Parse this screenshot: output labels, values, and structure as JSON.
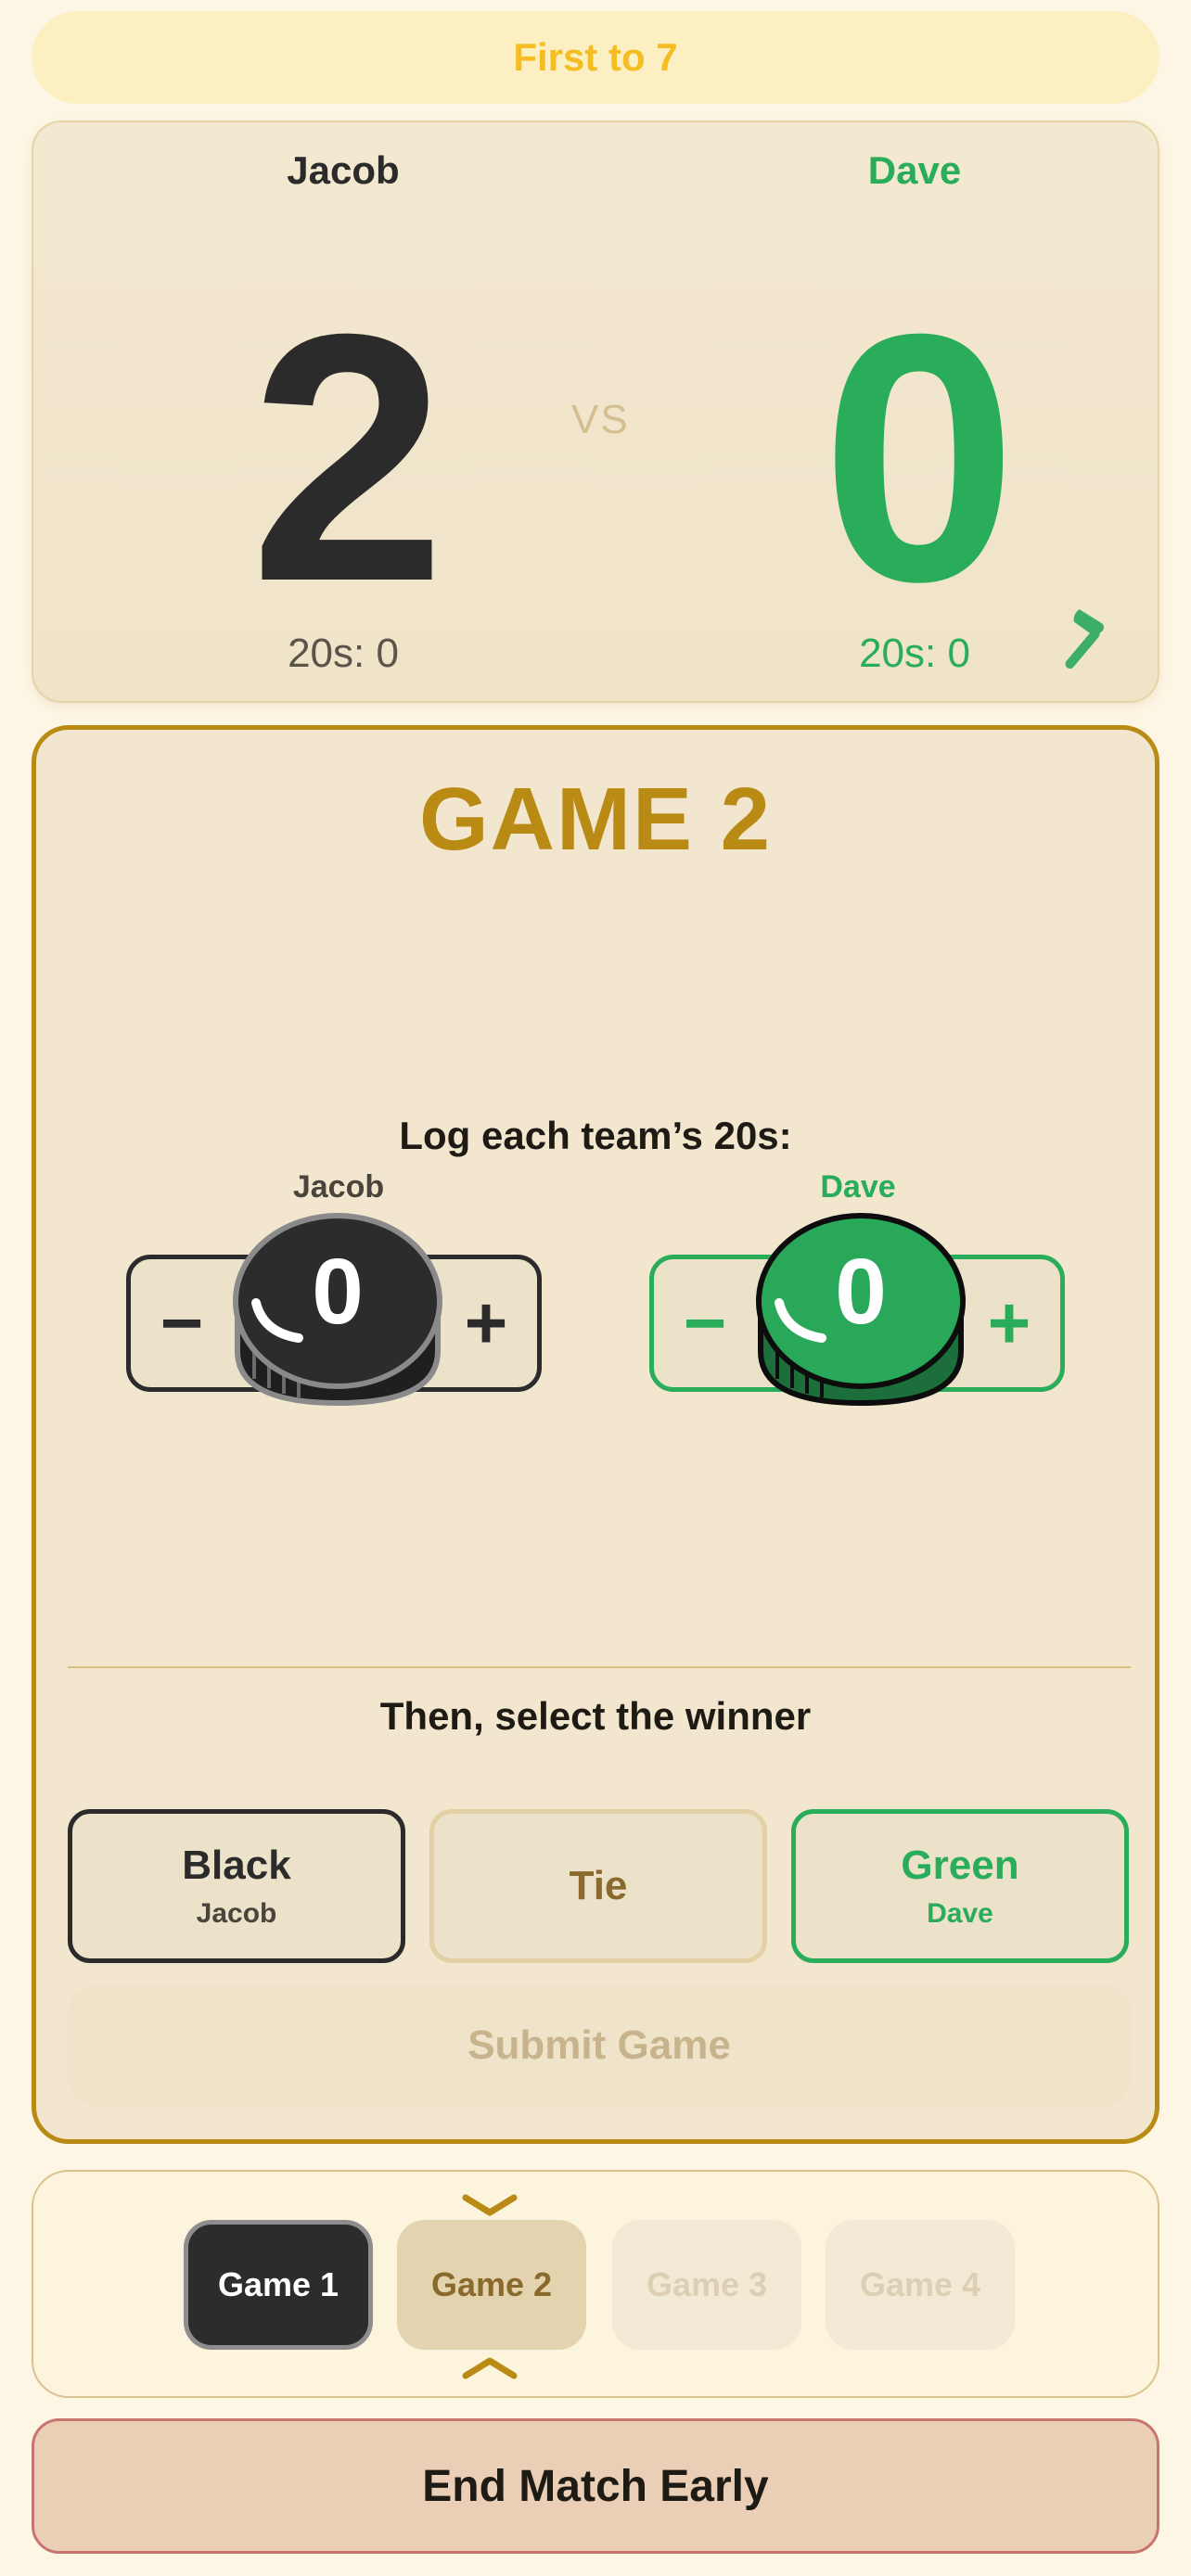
{
  "match": {
    "goal_label": "First to 7",
    "vs_label": "VS"
  },
  "colors": {
    "black_team": "#2b2b2b",
    "green_team": "#29ad5a",
    "gold_accent": "#b98a14",
    "goal_pill_text": "#f4bd22",
    "end_button_bg": "#eacfb6"
  },
  "scoreboard": {
    "left": {
      "name": "Jacob",
      "score": "2",
      "twenties": "20s: 0"
    },
    "right": {
      "name": "Dave",
      "score": "0",
      "twenties": "20s: 0"
    },
    "edit_icon": "hammer-icon"
  },
  "game": {
    "title": "GAME 2",
    "log_label": "Log each team’s 20s:",
    "left_stepper": {
      "name": "Jacob",
      "value": "0",
      "minus": "−",
      "plus": "+"
    },
    "right_stepper": {
      "name": "Dave",
      "value": "0",
      "minus": "−",
      "plus": "+"
    },
    "winner_label": "Then, select the winner",
    "winner_options": [
      {
        "main": "Black",
        "sub": "Jacob"
      },
      {
        "main": "Tie",
        "sub": ""
      },
      {
        "main": "Green",
        "sub": "Dave"
      }
    ],
    "submit_label": "Submit Game"
  },
  "nav": {
    "tabs": [
      {
        "label": "Game 1",
        "state": "completed"
      },
      {
        "label": "Game 2",
        "state": "active"
      },
      {
        "label": "Game 3",
        "state": "disabled"
      },
      {
        "label": "Game 4",
        "state": "disabled"
      }
    ],
    "up_icon": "chevron-up-icon",
    "down_icon": "chevron-down-icon"
  },
  "end_match_label": "End Match Early"
}
